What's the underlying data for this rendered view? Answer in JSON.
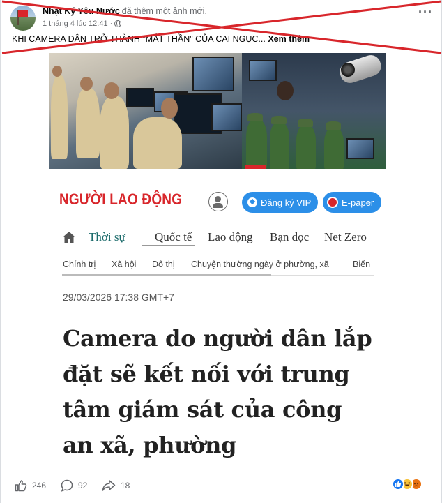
{
  "post": {
    "author": "Nhật Ký Yêu Nước",
    "action": "đã thêm một ảnh mới.",
    "timestamp": "1 tháng 4 lúc 12:41",
    "privacy_icon": "globe-icon",
    "more_icon": "more-icon",
    "caption": "KHI CAMERA DÂN TRỞ THÀNH \"MẮT THẦN\" CỦA CAI NGỤC...",
    "see_more": "Xem thêm",
    "cross_color": "#d8262b"
  },
  "article": {
    "logo": "NGƯỜI LAO ĐỘNG",
    "vip_button": "Đăng ký VIP",
    "epaper_button": "E-paper",
    "nav": [
      "Thời sự",
      "Quốc tế",
      "Lao động",
      "Bạn đọc",
      "Net Zero"
    ],
    "subnav": [
      "Chính trị",
      "Xã hội",
      "Đô thị",
      "Chuyện thường ngày ở phường, xã",
      "Biển"
    ],
    "date": "29/03/2026 17:38 GMT+7",
    "headline": "Camera do người dân lắp đặt sẽ kết nối với trung tâm giám sát của công an xã, phường",
    "brand_color": "#d8262b",
    "button_color": "#2c8fe8"
  },
  "footer": {
    "likes": "246",
    "comments": "92",
    "shares": "18",
    "reactions": [
      "like",
      "haha",
      "angry"
    ]
  }
}
